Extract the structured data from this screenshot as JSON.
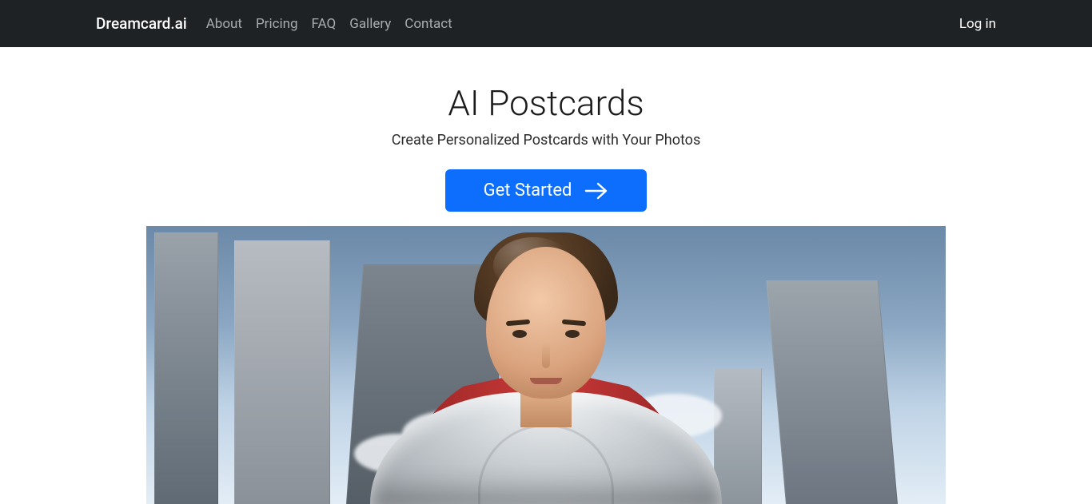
{
  "nav": {
    "brand": "Dreamcard.ai",
    "links": [
      "About",
      "Pricing",
      "FAQ",
      "Gallery",
      "Contact"
    ],
    "login": "Log in"
  },
  "hero": {
    "title": "AI Postcards",
    "subtitle": "Create Personalized Postcards with Your Photos",
    "cta": "Get Started"
  }
}
